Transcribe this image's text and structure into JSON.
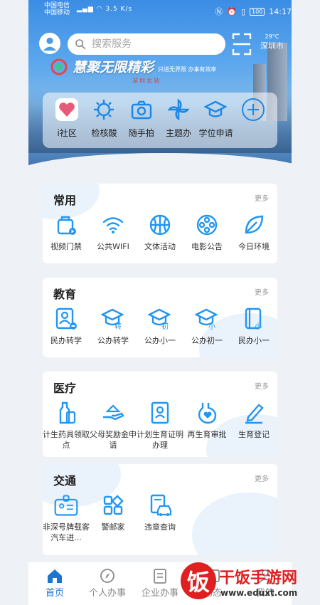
{
  "status_bar": {
    "carrier1": "中国电信",
    "carrier2": "中国移动",
    "net_speed": "3.5 K/s",
    "battery": "100",
    "time": "14:17"
  },
  "header": {
    "search_placeholder": "搜索服务",
    "temperature": "29°C",
    "city": "深圳市",
    "banner_title": "慧聚无限精彩",
    "banner_slogan": "只进无界限 办事有效率",
    "banner_sub": "深圳北站"
  },
  "quick_services": [
    {
      "label": "i社区",
      "icon": "heart-community-icon"
    },
    {
      "label": "检核酸",
      "icon": "virus-icon"
    },
    {
      "label": "随手拍",
      "icon": "camera-icon"
    },
    {
      "label": "主题办",
      "icon": "pinwheel-icon"
    },
    {
      "label": "学位申请",
      "icon": "graduation-cap-icon"
    },
    {
      "label": "",
      "icon": "plus-icon"
    }
  ],
  "sections": [
    {
      "title": "常用",
      "more": "更多",
      "items": [
        {
          "label": "视频门禁",
          "icon": "video-door-icon"
        },
        {
          "label": "公共WIFI",
          "icon": "wifi-icon"
        },
        {
          "label": "文体活动",
          "icon": "basketball-icon"
        },
        {
          "label": "电影公告",
          "icon": "film-reel-icon"
        },
        {
          "label": "今日环境",
          "icon": "leaf-icon"
        }
      ]
    },
    {
      "title": "教育",
      "more": "更多",
      "items": [
        {
          "label": "民办转学",
          "icon": "student-card-icon"
        },
        {
          "label": "公办转学",
          "icon": "cap-transfer-icon",
          "badge": "转"
        },
        {
          "label": "公办小一",
          "icon": "cap-first-icon",
          "badge": "初"
        },
        {
          "label": "公办初一",
          "icon": "cap-small-icon",
          "badge": "小"
        },
        {
          "label": "民办小一",
          "icon": "book-small-icon",
          "badge": "小"
        }
      ]
    },
    {
      "title": "医疗",
      "more": "更多",
      "items": [
        {
          "label": "计生药具领取点",
          "icon": "bottle-icon"
        },
        {
          "label": "父母奖励金申请",
          "icon": "hand-money-icon"
        },
        {
          "label": "计划生育证明办理",
          "icon": "certificate-icon"
        },
        {
          "label": "再生育审批",
          "icon": "pregnancy-heart-icon"
        },
        {
          "label": "生育登记",
          "icon": "pen-register-icon"
        }
      ]
    },
    {
      "title": "交通",
      "more": "更多",
      "items": [
        {
          "label": "非深号牌载客汽车进...",
          "icon": "id-badge-icon"
        },
        {
          "label": "警邮家",
          "icon": "grid-apps-icon"
        },
        {
          "label": "违章查询",
          "icon": "car-violation-icon"
        }
      ]
    }
  ],
  "tabbar": [
    {
      "label": "首页",
      "icon": "home-icon",
      "active": true
    },
    {
      "label": "个人办事",
      "icon": "compass-icon",
      "active": false
    },
    {
      "label": "企业办事",
      "icon": "building-icon",
      "active": false
    },
    {
      "label": "动态",
      "icon": "news-icon",
      "active": false
    },
    {
      "label": "我的",
      "icon": "user-icon",
      "active": false
    }
  ],
  "watermark": {
    "glyph": "饭",
    "name": "干饭手游网",
    "url": "www.eduxt.com"
  },
  "colors": {
    "accent": "#1e88e5",
    "icon_blue": "#2196f3",
    "watermark_red": "#e02020"
  }
}
